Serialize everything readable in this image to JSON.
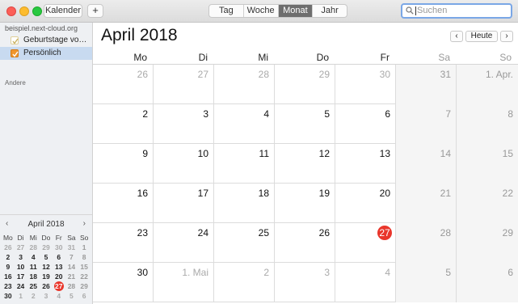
{
  "toolbar": {
    "calendars_label": "Kalender",
    "add_label": "+",
    "views": [
      "Tag",
      "Woche",
      "Monat",
      "Jahr"
    ],
    "active_view": 2,
    "search_placeholder": "Suchen"
  },
  "sidebar": {
    "account": "beispiel.next-cloud.org",
    "calendars": [
      {
        "label": "Geburtstage vo…",
        "checked": true,
        "color": "#e0d09a"
      },
      {
        "label": "Persönlich",
        "checked": true,
        "color": "#f0962d"
      }
    ],
    "other_heading": "Andere"
  },
  "mini_calendar": {
    "title": "April 2018",
    "prev": "‹",
    "next": "›",
    "weekdays": [
      "Mo",
      "Di",
      "Mi",
      "Do",
      "Fr",
      "Sa",
      "So"
    ],
    "weeks": [
      [
        "26",
        "27",
        "28",
        "29",
        "30",
        "31",
        "1"
      ],
      [
        "2",
        "3",
        "4",
        "5",
        "6",
        "7",
        "8"
      ],
      [
        "9",
        "10",
        "11",
        "12",
        "13",
        "14",
        "15"
      ],
      [
        "16",
        "17",
        "18",
        "19",
        "20",
        "21",
        "22"
      ],
      [
        "23",
        "24",
        "25",
        "26",
        "27",
        "28",
        "29"
      ],
      [
        "30",
        "1",
        "2",
        "3",
        "4",
        "5",
        "6"
      ]
    ]
  },
  "main": {
    "title": "April 2018",
    "prev": "‹",
    "today_label": "Heute",
    "next": "›",
    "weekdays": [
      "Mo",
      "Di",
      "Mi",
      "Do",
      "Fr",
      "Sa",
      "So"
    ],
    "weeks": [
      [
        "26",
        "27",
        "28",
        "29",
        "30",
        "31",
        "1. Apr."
      ],
      [
        "2",
        "3",
        "4",
        "5",
        "6",
        "7",
        "8"
      ],
      [
        "9",
        "10",
        "11",
        "12",
        "13",
        "14",
        "15"
      ],
      [
        "16",
        "17",
        "18",
        "19",
        "20",
        "21",
        "22"
      ],
      [
        "23",
        "24",
        "25",
        "26",
        "27",
        "28",
        "29"
      ],
      [
        "30",
        "1. Mai",
        "2",
        "3",
        "4",
        "5",
        "6"
      ]
    ],
    "today_color": "#e9362b"
  }
}
